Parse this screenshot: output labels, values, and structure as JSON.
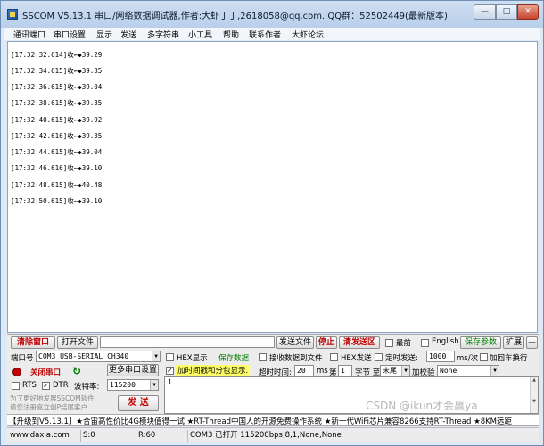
{
  "window": {
    "title": "SSCOM V5.13.1 串口/网络数据调试器,作者:大虾丁丁,2618058@qq.com. QQ群：52502449(最新版本)",
    "minimize": "—",
    "maximize": "□",
    "close": "✕"
  },
  "menu": [
    "通讯端口",
    "串口设置",
    "显示",
    "发送",
    "多字符串",
    "小工具",
    "帮助",
    "联系作者",
    "大虾论坛"
  ],
  "receive": {
    "lines": [
      "[17:32:32.614]收←◆39.29",
      "[17:32:34.615]收←◆39.35",
      "[17:32:36.615]收←◆39.04",
      "[17:32:38.615]收←◆39.35",
      "[17:32:40.615]收←◆39.92",
      "[17:32:42.616]收←◆39.35",
      "[17:32:44.615]收←◆39.04",
      "[17:32:46.616]收←◆39.10",
      "[17:32:48.615]收←◆40.48",
      "[17:32:50.615]收←◆39.10"
    ]
  },
  "row1": {
    "clear_window": "清除窗口",
    "open_file": "打开文件",
    "send_file": "发送文件",
    "stop": "停止",
    "clear_send": "清发送区",
    "latest": "最前",
    "english": "English",
    "save_params": "保存参数",
    "expand": "扩展",
    "collapse": "—"
  },
  "row2": {
    "port_label": "端口号",
    "port_value": "COM3 USB-SERIAL CH340",
    "hex_display": "HEX显示",
    "save_data": "保存数据",
    "recv_to_file": "接收数据到文件",
    "hex_send": "HEX发送",
    "timed_send": "定时发送:",
    "interval_value": "1000",
    "interval_unit": "ms/次",
    "add_newline": "加回车换行"
  },
  "row3": {
    "close_port": "关闭串口",
    "more_settings": "更多串口设置",
    "timestamp_label": "加时间戳和分包显示.",
    "timeout_label": "超时时间:",
    "timeout_value": "20",
    "timeout_unit": "ms",
    "byte_prefix": "第",
    "byte_value": "1",
    "byte_suffix": "字节 至",
    "end_value": "末尾",
    "checksum_label": "加校验",
    "checksum_value": "None"
  },
  "row4": {
    "rts": "RTS",
    "dtr": "DTR",
    "baud_label": "波特率:",
    "baud_value": "115200"
  },
  "row5": {
    "promo": "为了更好地发展SSCOM软件\n请您注册嘉立创P结尾客户",
    "send": "发 送",
    "send_text": "1"
  },
  "ticker": "【升级到V5.13.1】★合宙高性价比4G模块值得一试 ★RT-Thread中国人的开源免费操作系统 ★新一代WiFi芯片兼容8266支持RT-Thread ★8KM远距",
  "status": {
    "site": "www.daxia.com",
    "s": "S:0",
    "r": "R:60",
    "port": "COM3 已打开  115200bps,8,1,None,None"
  },
  "watermark": "CSDN @ikun才会赢ya",
  "colors": {
    "accent_red": "#c00000",
    "accent_green": "#007a00",
    "highlight_yellow": "#ffff66"
  }
}
